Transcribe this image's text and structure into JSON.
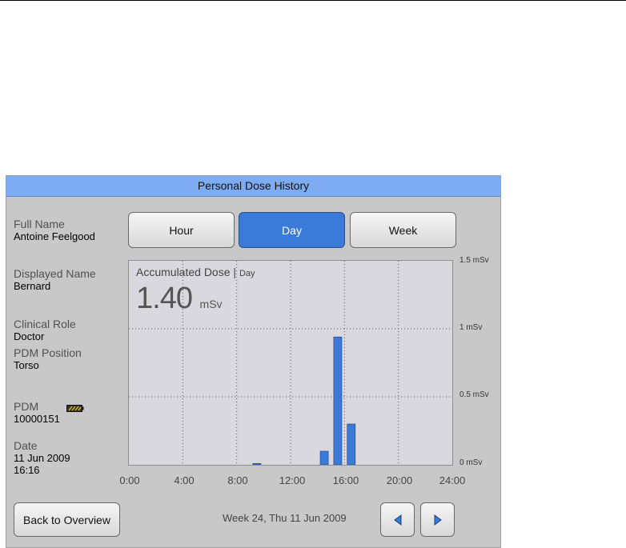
{
  "window": {
    "title": "Personal Dose History"
  },
  "person": {
    "full_name_label": "Full Name",
    "full_name": "Antoine Feelgood",
    "displayed_name_label": "Displayed Name",
    "displayed_name": "Bernard",
    "clinical_role_label": "Clinical Role",
    "clinical_role": "Doctor",
    "pdm_position_label": "PDM Position",
    "pdm_position": "Torso",
    "pdm_label": "PDM",
    "pdm": "10000151",
    "date_label": "Date",
    "date": "11 Jun 2009",
    "time": "16:16"
  },
  "tabs": [
    {
      "label": "Hour",
      "active": false
    },
    {
      "label": "Day",
      "active": true
    },
    {
      "label": "Week",
      "active": false
    }
  ],
  "accumulated": {
    "title": "Accumulated Dose",
    "period": "Day",
    "value": "1.40",
    "unit": "mSv"
  },
  "chart_data": {
    "type": "bar",
    "xlim": [
      0,
      24
    ],
    "ylim": [
      0,
      1.5
    ],
    "x_tick_labels": [
      "0:00",
      "4:00",
      "8:00",
      "12:00",
      "16:00",
      "20:00",
      "24:00"
    ],
    "y_tick_labels": [
      "0 mSv",
      "0.5 mSv",
      "1 mSv",
      "1.5 mSv"
    ],
    "y_ticks": [
      0,
      0.5,
      1,
      1.5
    ],
    "grid": true,
    "bar_color": "#3a7ad8",
    "bars": [
      {
        "hour": 9,
        "value": 0.01
      },
      {
        "hour": 14,
        "value": 0.1
      },
      {
        "hour": 15,
        "value": 0.94
      },
      {
        "hour": 16,
        "value": 0.3
      }
    ]
  },
  "footer": {
    "back_label": "Back to Overview",
    "week_label": "Week 24, Thu 11 Jun 2009",
    "prev_icon": "triangle-left-icon",
    "next_icon": "triangle-right-icon"
  },
  "colors": {
    "title_bar": "#7dacf2",
    "accent": "#3a7ad8",
    "panel": "#c8c8c8"
  }
}
